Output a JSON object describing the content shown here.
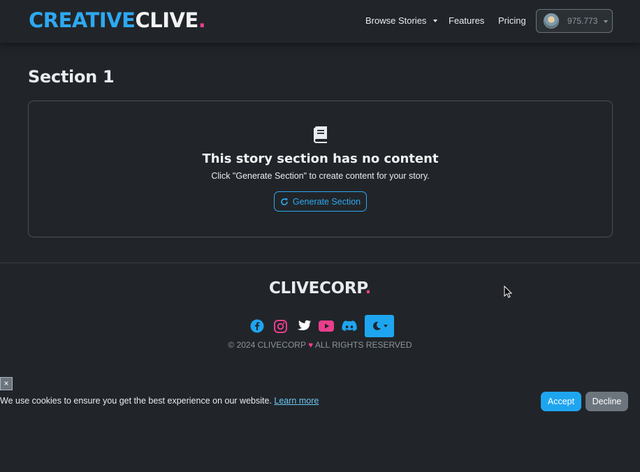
{
  "navbar": {
    "brand_part1": "CREATIVE",
    "brand_part2": "CLIVE",
    "brand_dot": ".",
    "links": {
      "browse": "Browse Stories",
      "features": "Features",
      "pricing": "Pricing"
    },
    "user": {
      "credits": "975.773"
    }
  },
  "main": {
    "section_title": "Section 1",
    "empty_title": "This story section has no content",
    "empty_desc": "Click \"Generate Section\" to create content for your story.",
    "generate_label": "Generate Section"
  },
  "footer": {
    "brand": "CLIVECORP",
    "brand_dot": ".",
    "social": [
      "facebook-icon",
      "instagram-icon",
      "twitter-icon",
      "youtube-icon",
      "discord-icon"
    ],
    "copyright_pre": "© 2024 CLIVECORP",
    "copyright_post": "ALL RIGHTS RESERVED"
  },
  "cookie": {
    "close_label": "×",
    "text": "We use cookies to ensure you get the best experience on our website.",
    "learn_more": "Learn more",
    "accept": "Accept",
    "decline": "Decline"
  },
  "colors": {
    "background": "#212529",
    "accent_blue": "#1ea5f0",
    "accent_pink": "#e83e8c",
    "secondary": "#6c757d"
  }
}
